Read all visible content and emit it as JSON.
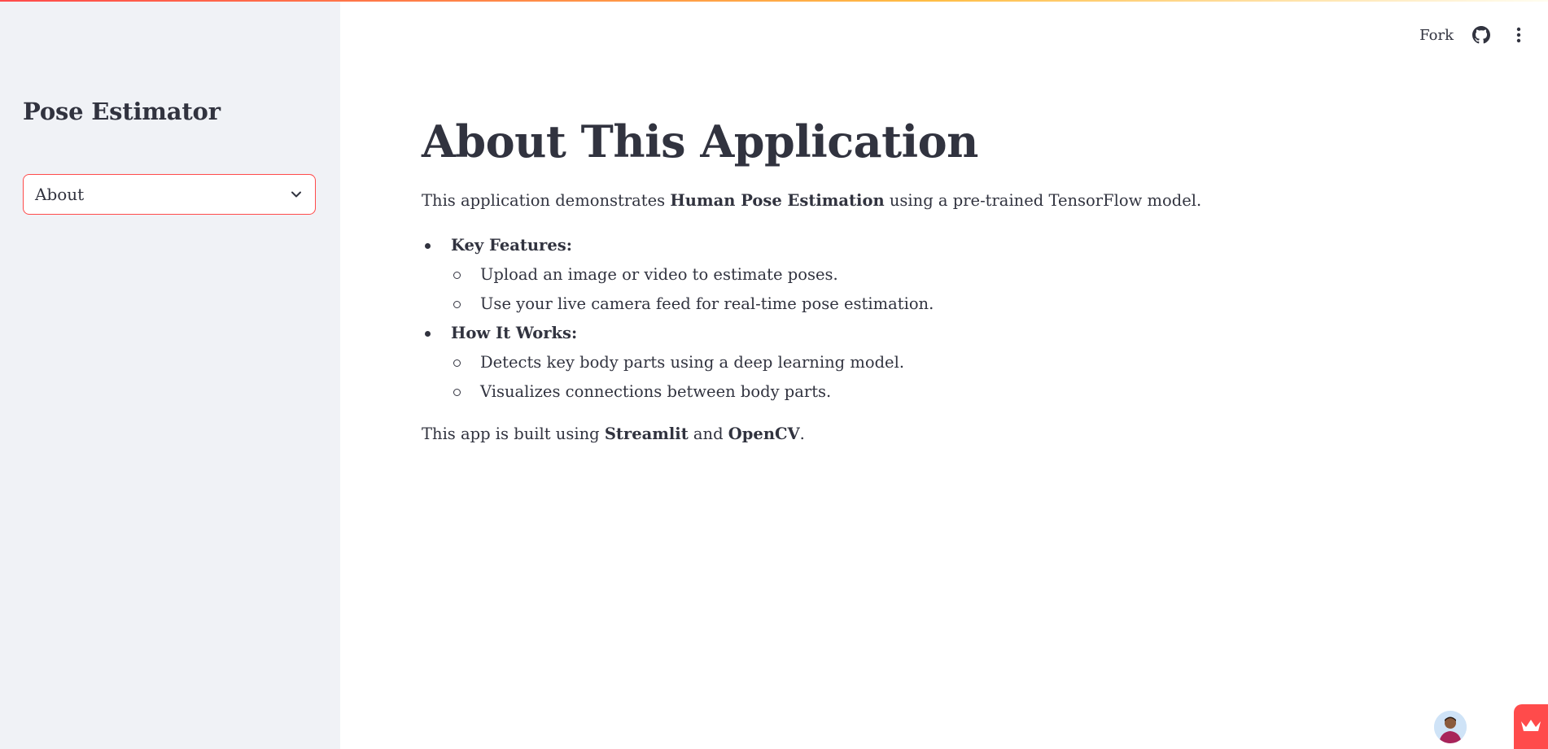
{
  "sidebar": {
    "title": "Pose Estimator",
    "select": {
      "value": "About"
    }
  },
  "header": {
    "fork_label": "Fork",
    "icons": [
      "github-icon",
      "more-vertical-icon"
    ]
  },
  "main": {
    "title": "About This Application",
    "intro": {
      "before": "This application demonstrates ",
      "bold": "Human Pose Estimation",
      "after": " using a pre-trained TensorFlow model."
    },
    "sections": [
      {
        "label": "Key Features:",
        "items": [
          "Upload an image or video to estimate poses.",
          "Use your live camera feed for real-time pose estimation."
        ]
      },
      {
        "label": "How It Works:",
        "items": [
          "Detects key body parts using a deep learning model.",
          "Visualizes connections between body parts."
        ]
      }
    ],
    "footer": {
      "before": "This app is built using ",
      "bold1": "Streamlit",
      "middle": " and ",
      "bold2": "OpenCV",
      "after": "."
    }
  },
  "colors": {
    "accent": "#ff4b4b",
    "sidebar_bg": "#f0f2f6",
    "text": "#31333f"
  }
}
